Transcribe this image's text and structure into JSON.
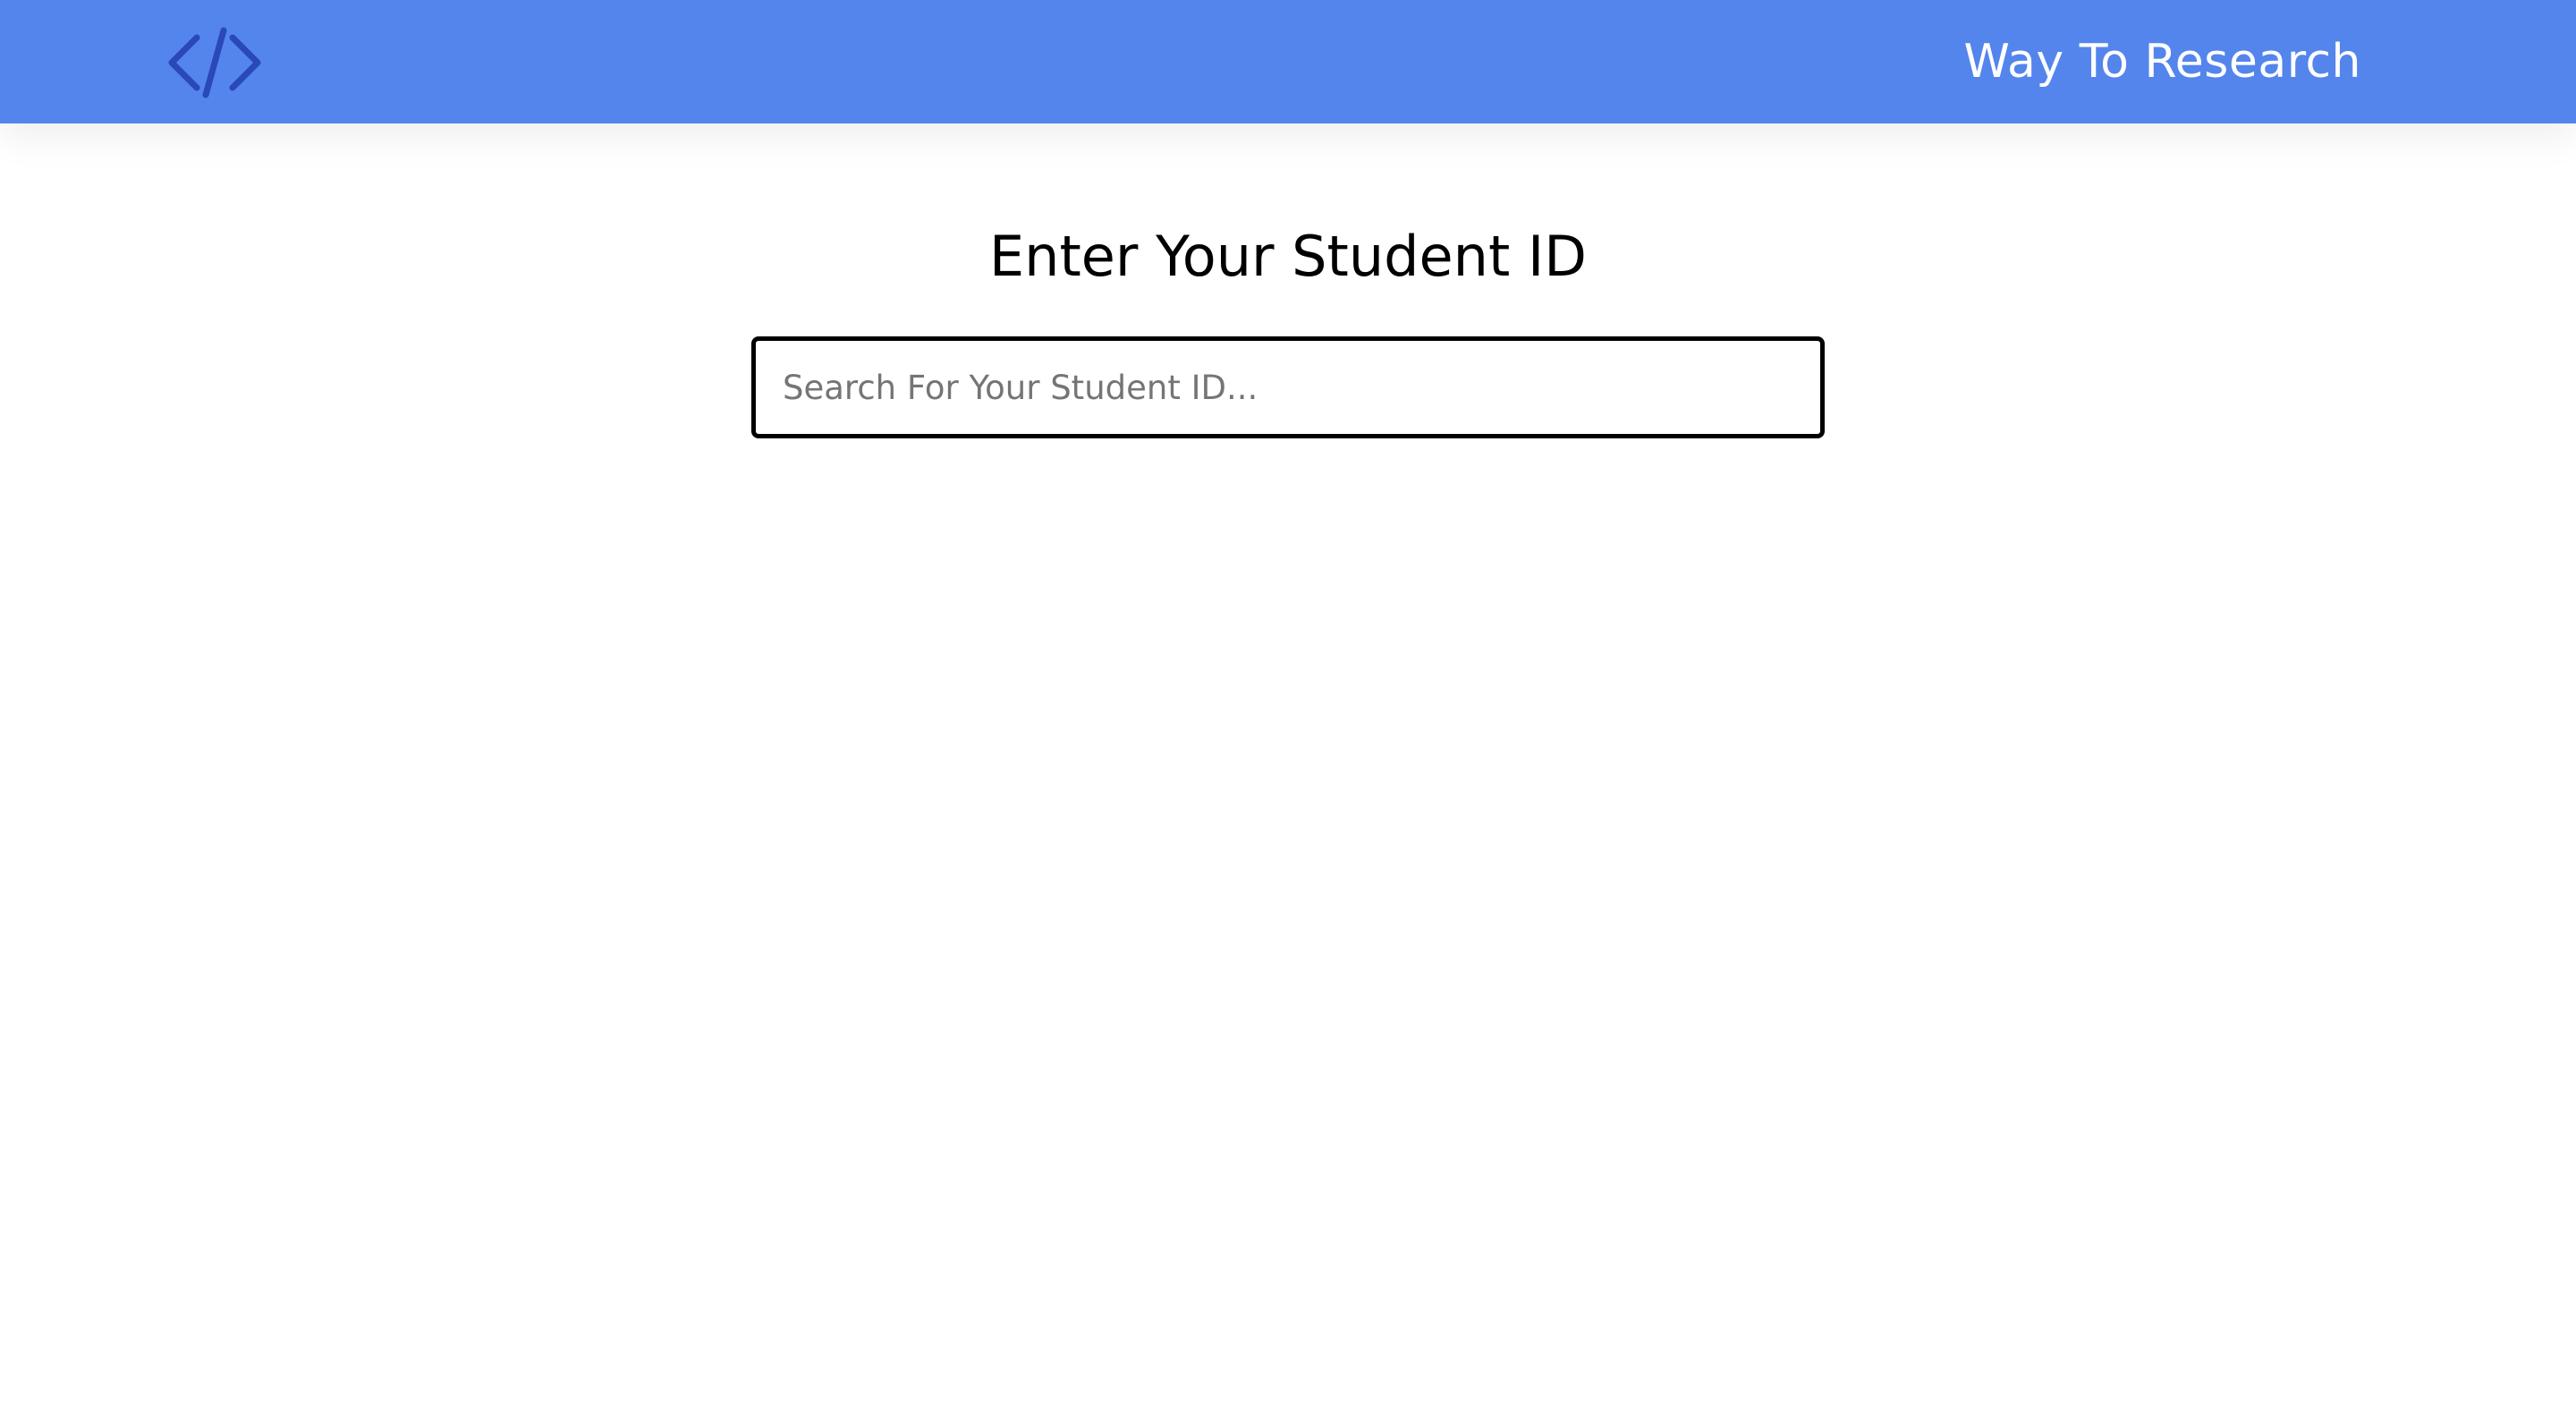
{
  "navbar": {
    "logo_icon": "code-brackets-icon",
    "brand_title": "Way To Research",
    "background_color": "#5485ed",
    "logo_color": "#2a48b8"
  },
  "main": {
    "title": "Enter Your Student ID",
    "search": {
      "value": "",
      "placeholder": "Search For Your Student ID..."
    }
  }
}
